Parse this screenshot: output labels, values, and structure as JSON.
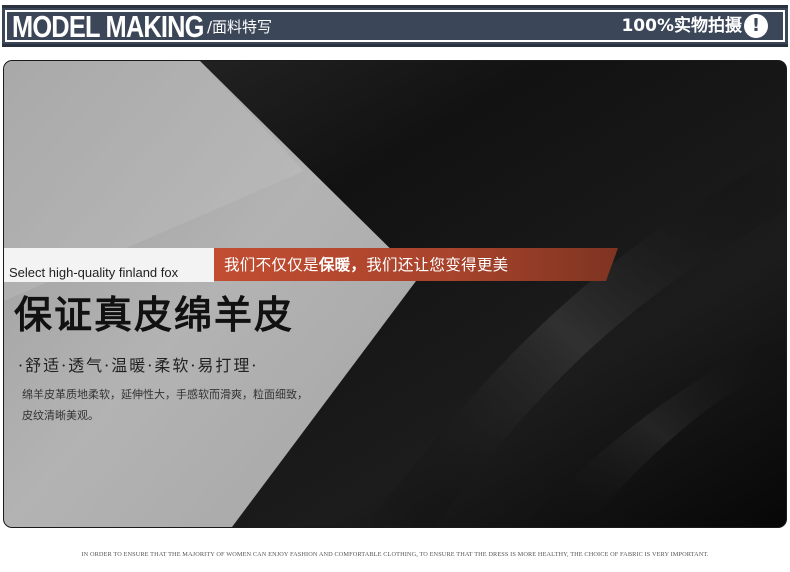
{
  "header": {
    "brand": "MODEL MAKING",
    "subtitle": "/面料特写",
    "badge": "100%实物拍摄",
    "badge_icon": "exclamation-icon",
    "bar_color": "#3b4658"
  },
  "photo": {
    "strip_label": "Select high-quality finland fox",
    "banner_part1": "我们不仅仅是",
    "banner_emph": "保暖，",
    "banner_part2": "我们还让您变得更美",
    "headline": "保证真皮绵羊皮",
    "features": "·舒适·透气·温暖·柔软·易打理·",
    "desc_line1": "绵羊皮革质地柔软，延伸性大，手感软而滑爽，粒面细致，",
    "desc_line2": "皮纹清晰美观。",
    "banner_color": "#b6472c"
  },
  "footer": {
    "text": "IN ORDER TO ENSURE THAT THE MAJORITY OF WOMEN CAN ENJOY FASHION AND COMFORTABLE CLOTHING, TO ENSURE THAT THE DRESS IS MORE HEALTHY, THE CHOICE OF FABRIC IS VERY IMPORTANT."
  }
}
